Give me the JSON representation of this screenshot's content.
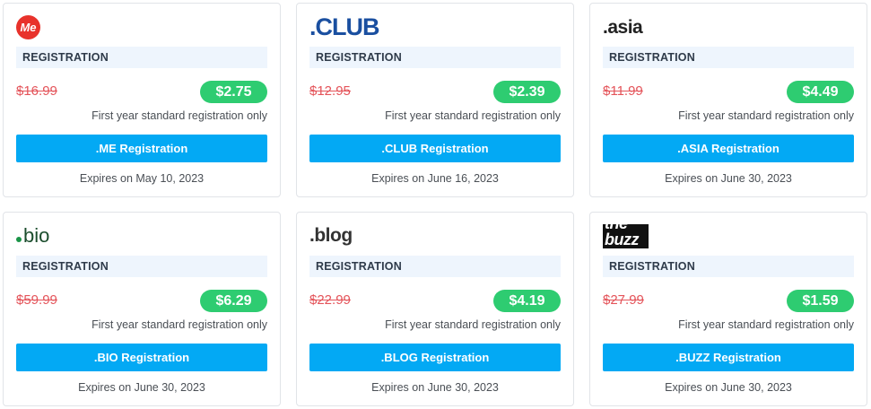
{
  "cards": [
    {
      "logo_text": "Me",
      "registration_label": "REGISTRATION",
      "old_price": "$16.99",
      "new_price": "$2.75",
      "first_year_note": "First year standard registration only",
      "button_label": ".ME Registration",
      "expires": "Expires on May 10, 2023"
    },
    {
      "logo_text": ".CLUB",
      "registration_label": "REGISTRATION",
      "old_price": "$12.95",
      "new_price": "$2.39",
      "first_year_note": "First year standard registration only",
      "button_label": ".CLUB Registration",
      "expires": "Expires on June 16, 2023"
    },
    {
      "logo_text": ".asia",
      "registration_label": "REGISTRATION",
      "old_price": "$11.99",
      "new_price": "$4.49",
      "first_year_note": "First year standard registration only",
      "button_label": ".ASIA Registration",
      "expires": "Expires on June 30, 2023"
    },
    {
      "logo_text": "bio",
      "registration_label": "REGISTRATION",
      "old_price": "$59.99",
      "new_price": "$6.29",
      "first_year_note": "First year standard registration only",
      "button_label": ".BIO Registration",
      "expires": "Expires on June 30, 2023"
    },
    {
      "logo_text": ".blog",
      "registration_label": "REGISTRATION",
      "old_price": "$22.99",
      "new_price": "$4.19",
      "first_year_note": "First year standard registration only",
      "button_label": ".BLOG Registration",
      "expires": "Expires on June 30, 2023"
    },
    {
      "logo_text": "the buzz",
      "registration_label": "REGISTRATION",
      "old_price": "$27.99",
      "new_price": "$1.59",
      "first_year_note": "First year standard registration only",
      "button_label": ".BUZZ Registration",
      "expires": "Expires on June 30, 2023"
    }
  ],
  "colors": {
    "price_badge": "#2ecc71",
    "button": "#03a9f4",
    "strike_price": "#e4545a",
    "registration_bar": "#eef5fd"
  }
}
